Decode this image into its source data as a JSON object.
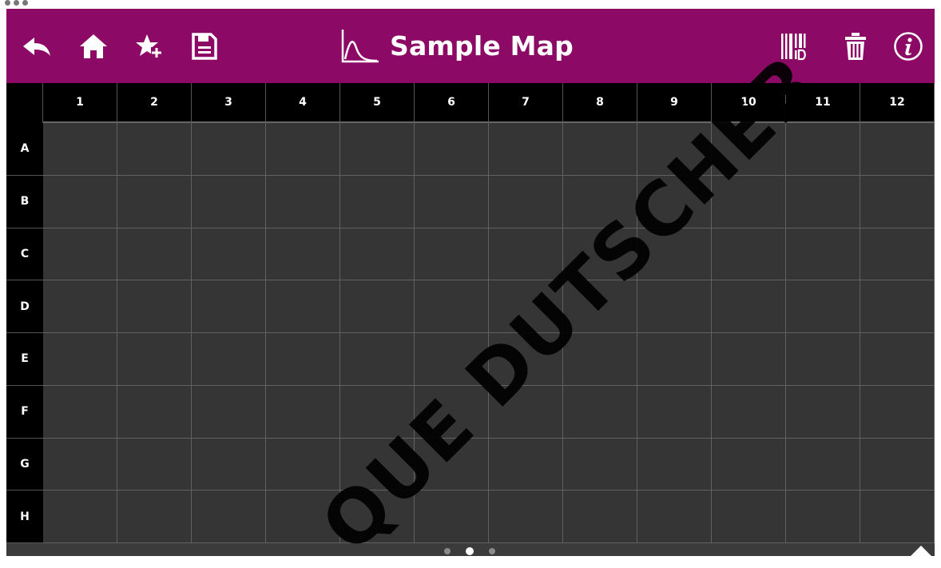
{
  "header": {
    "title": "Sample Map",
    "background_color": "#8c0a66",
    "left_icons": [
      "back-arrow-icon",
      "home-icon",
      "star-add-icon",
      "save-icon"
    ],
    "title_icon": "chart-curve-icon",
    "right_icons": [
      "barcode-id-icon",
      "trash-icon",
      "info-icon"
    ]
  },
  "plate": {
    "columns": [
      "1",
      "2",
      "3",
      "4",
      "5",
      "6",
      "7",
      "8",
      "9",
      "10",
      "11",
      "12"
    ],
    "rows": [
      "A",
      "B",
      "C",
      "D",
      "E",
      "F",
      "G",
      "H"
    ],
    "cell_color": "#353535"
  },
  "pager": {
    "pages": 3,
    "active": 2
  },
  "watermark": "QUE DUTSCHER"
}
